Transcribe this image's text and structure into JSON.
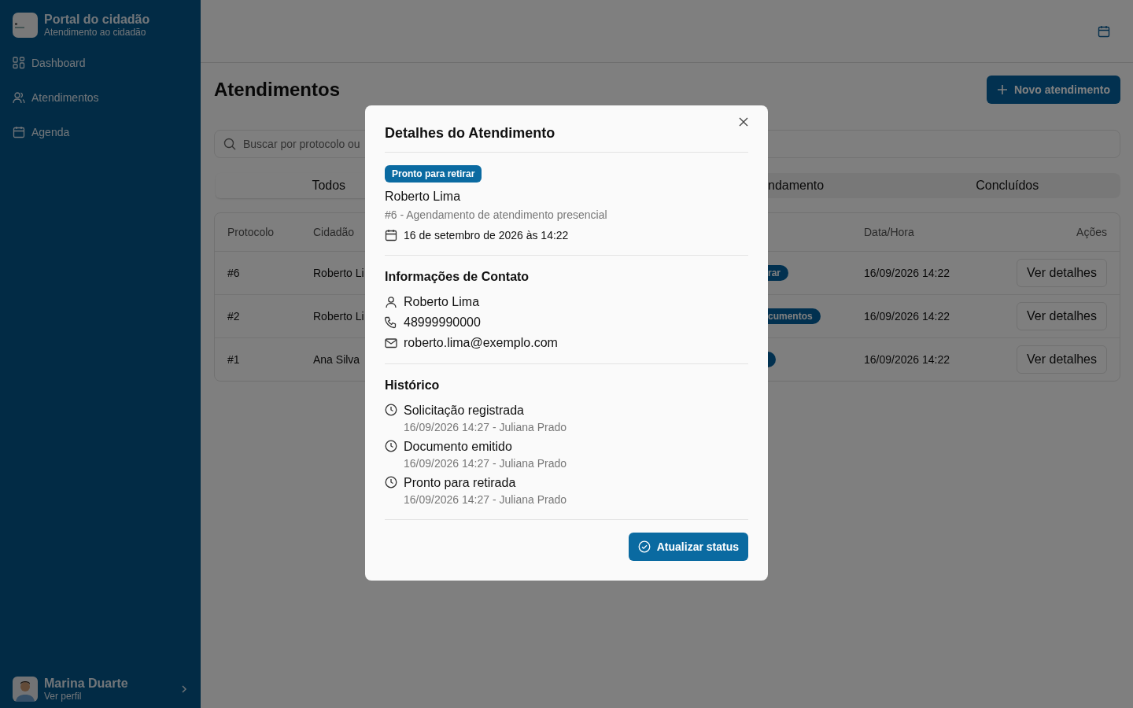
{
  "sidebar": {
    "title": "Portal do cidadão",
    "subtitle": "Atendimento ao cidadão",
    "items": [
      {
        "label": "Dashboard",
        "kind": "grid",
        "selected": false
      },
      {
        "label": "Atendimentos",
        "kind": "users",
        "selected": false
      },
      {
        "label": "Agenda",
        "kind": "calendar",
        "selected": false
      }
    ],
    "user": {
      "name": "Marina Duarte",
      "link": "Ver perfil"
    }
  },
  "page": {
    "title": "Atendimentos",
    "new_button": "Novo atendimento"
  },
  "search": {
    "placeholder": "Buscar por protocolo ou"
  },
  "tabs": [
    {
      "label": "Todos",
      "selected": true,
      "partial": false
    },
    {
      "label": "ndamento",
      "selected": false,
      "partial": true
    },
    {
      "label": "Concluídos",
      "selected": false,
      "partial": false
    }
  ],
  "table": {
    "columns": [
      "Protocolo",
      "Cidadão",
      "Data/Hora",
      "Ações"
    ],
    "rows": [
      {
        "protocol": "#6",
        "citizen": "Roberto Li",
        "status": "rar",
        "datetime": "16/09/2026 14:22",
        "action": "Ver detalhes"
      },
      {
        "protocol": "#2",
        "citizen": "Roberto Li",
        "status": "cumentos",
        "datetime": "16/09/2026 14:22",
        "action": "Ver detalhes"
      },
      {
        "protocol": "#1",
        "citizen": "Ana Silva",
        "status": "",
        "datetime": "16/09/2026 14:22",
        "action": "Ver detalhes"
      }
    ]
  },
  "modal": {
    "title": "Detalhes do Atendimento",
    "status": "Pronto para retirar",
    "name": "Roberto Lima",
    "subtitle": "#6 - Agendamento de atendimento presencial",
    "date": "16 de setembro de 2026 às 14:22",
    "contact_title": "Informações de Contato",
    "contact": [
      {
        "kind": "person",
        "text": "Roberto Lima"
      },
      {
        "kind": "phone",
        "text": "48999990000"
      },
      {
        "kind": "email",
        "text": "roberto.lima@exemplo.com"
      }
    ],
    "history_title": "Histórico",
    "history": [
      {
        "title": "Solicitação registrada",
        "meta": "16/09/2026 14:27 - Juliana Prado"
      },
      {
        "title": "Documento emitido",
        "meta": "16/09/2026 14:27 - Juliana Prado"
      },
      {
        "title": "Pronto para retirada",
        "meta": "16/09/2026 14:27 - Juliana Prado"
      }
    ],
    "button": "Atualizar status"
  }
}
